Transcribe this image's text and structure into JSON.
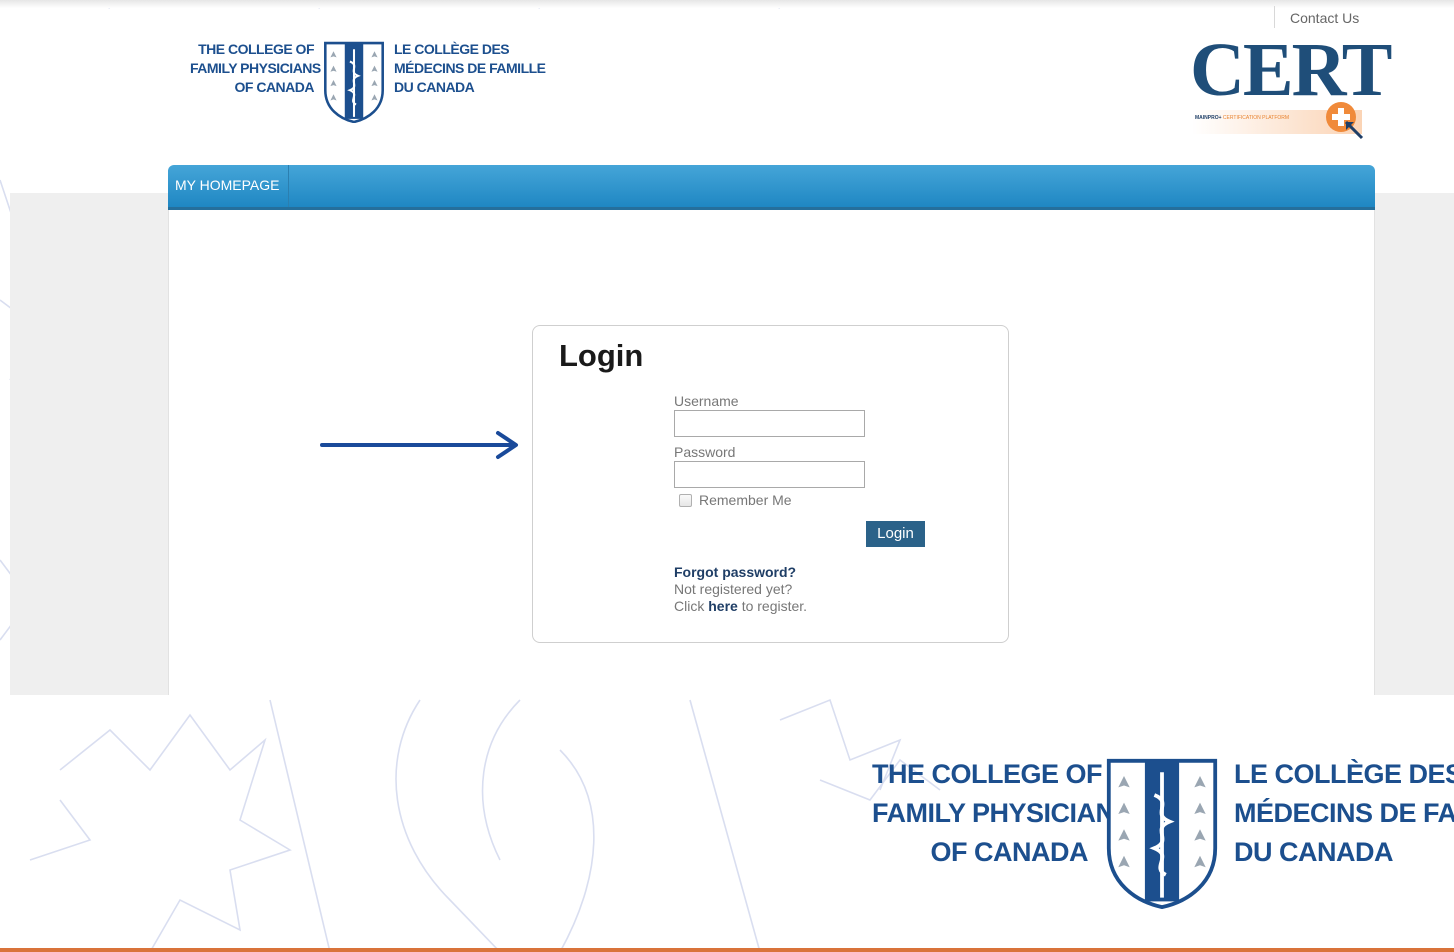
{
  "header": {
    "contact_label": "Contact Us",
    "logo": {
      "en_lines": [
        "THE COLLEGE OF",
        "FAMILY PHYSICIANS",
        "OF CANADA"
      ],
      "fr_lines": [
        "LE COLLÈGE DES",
        "MÉDECINS DE FAMILLE",
        "DU CANADA"
      ]
    },
    "cert": {
      "wordmark": "CERT",
      "tag_prefix": "MAINPRO+",
      "tag_rest": "CERTIFICATION PLATFORM"
    }
  },
  "nav": {
    "items": [
      {
        "label": "MY HOMEPAGE"
      }
    ]
  },
  "login": {
    "title": "Login",
    "username_label": "Username",
    "username_value": "",
    "password_label": "Password",
    "password_value": "",
    "remember_label": "Remember Me",
    "remember_checked": false,
    "button_label": "Login",
    "forgot_label": "Forgot password?",
    "not_registered_label": "Not registered yet?",
    "click_label": "Click",
    "here_label": "here",
    "to_register_label": "to register."
  },
  "footer_logo": {
    "en_lines": [
      "THE COLLEGE OF",
      "FAMILY PHYSICIANS",
      "OF CANADA"
    ],
    "fr_lines": [
      "LE COLLÈGE DES",
      "MÉDECINS DE FAMILL"
    ]
  },
  "colors": {
    "nav_blue": "#2b93cf",
    "brand_navy": "#1c4f8e",
    "button": "#2b6289",
    "accent_orange": "#e8822e",
    "arrow": "#1a4a9a"
  },
  "icons": {
    "shield": "cfpc-shield-icon",
    "arrow": "arrow-right-icon",
    "plus": "plus-icon",
    "cursor": "cursor-icon"
  }
}
